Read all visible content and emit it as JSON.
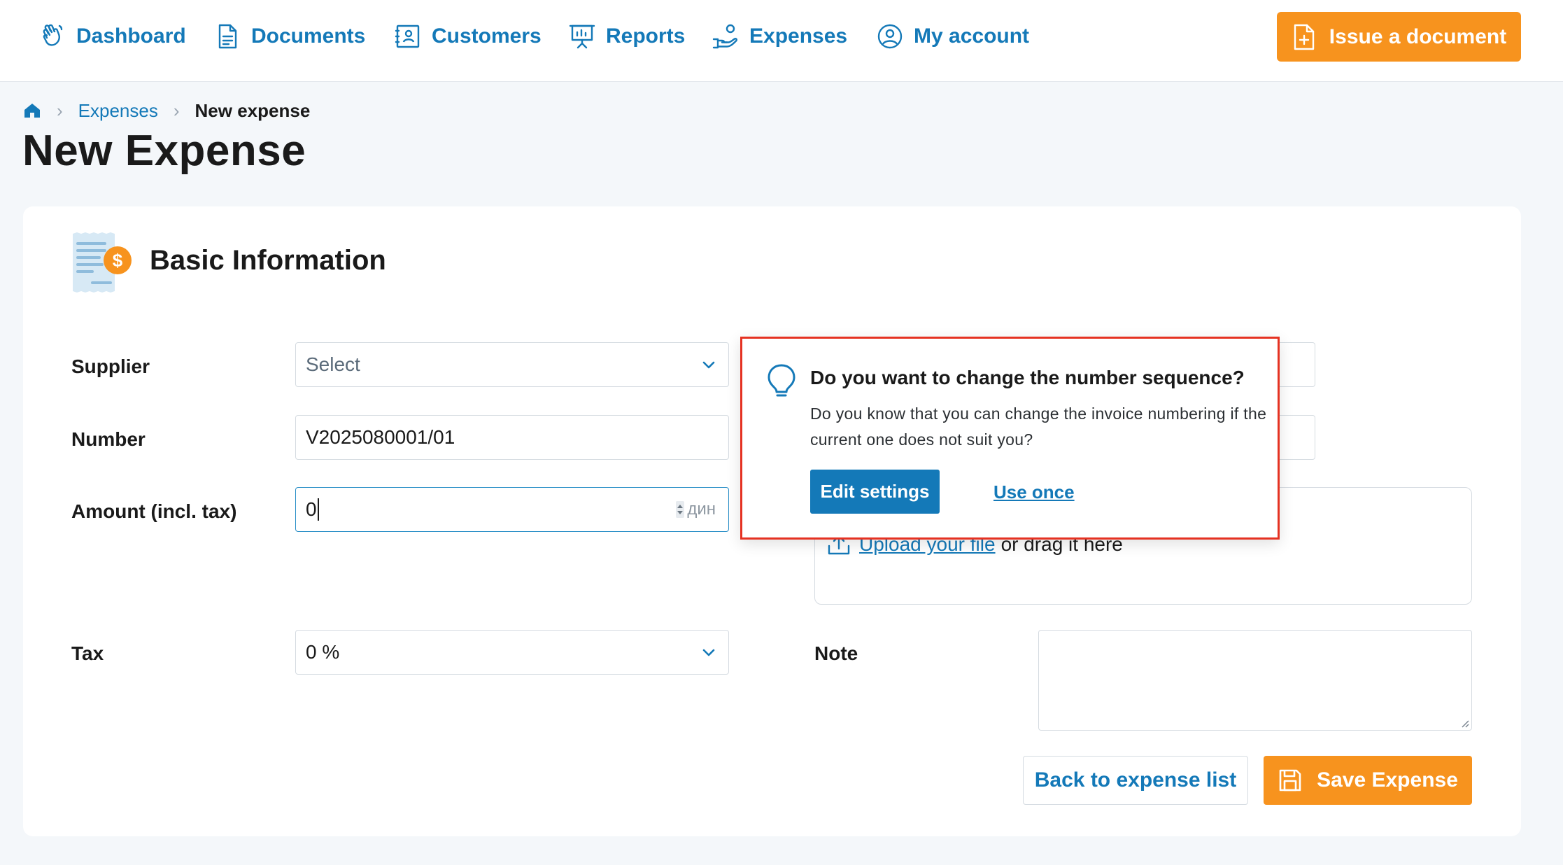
{
  "nav": {
    "items": [
      {
        "label": "Dashboard",
        "icon": "hand-wave-icon"
      },
      {
        "label": "Documents",
        "icon": "document-icon"
      },
      {
        "label": "Customers",
        "icon": "contact-card-icon"
      },
      {
        "label": "Reports",
        "icon": "presentation-board-icon"
      },
      {
        "label": "Expenses",
        "icon": "hand-coins-icon"
      },
      {
        "label": "My account",
        "icon": "user-circle-icon"
      }
    ],
    "issue_button": "Issue a document"
  },
  "breadcrumb": {
    "home_icon": "home-icon",
    "link": "Expenses",
    "current": "New expense"
  },
  "page": {
    "title": "New Expense"
  },
  "section": {
    "title": "Basic Information",
    "icon": "receipt-dollar-icon"
  },
  "form": {
    "supplier": {
      "label": "Supplier",
      "placeholder": "Select"
    },
    "number": {
      "label": "Number",
      "value": "V2025080001/01"
    },
    "amount": {
      "label": "Amount (incl. tax)",
      "value": "0",
      "currency": "дин"
    },
    "tax": {
      "label": "Tax",
      "value": "0 %"
    },
    "upload": {
      "link": "Upload your file",
      "text": "or drag it here"
    },
    "note": {
      "label": "Note",
      "value": ""
    }
  },
  "actions": {
    "back": "Back to expense list",
    "save": "Save Expense"
  },
  "popup": {
    "title": "Do you want to change the number sequence?",
    "body": "Do you know that you can change the invoice numbering if the current one does not suit you?",
    "edit_button": "Edit settings",
    "use_once": "Use once"
  },
  "colors": {
    "brand_blue": "#1479b8",
    "accent_orange": "#f7931e",
    "highlight_red": "#e53222"
  }
}
